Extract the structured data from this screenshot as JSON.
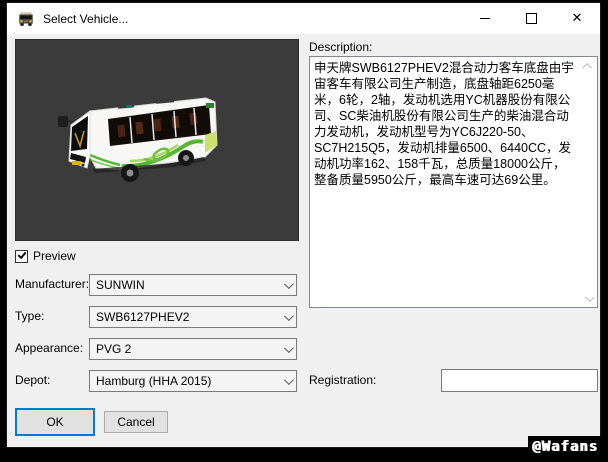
{
  "window": {
    "title": "Select Vehicle...",
    "glyphs": {
      "close": "✕"
    }
  },
  "preview": {
    "checkbox_label": "Preview",
    "checked": true
  },
  "description": {
    "label": "Description:",
    "text": "申天牌SWB6127PHEV2混合动力客车底盘由宇宙客车有限公司生产制造，底盘轴距6250毫米，6轮，2轴，发动机选用YC机器股份有限公司、SC柴油机股份有限公司生产的柴油混合动力发动机，发动机型号为YC6J220-50、SC7H215Q5，发动机排量6500、6440CC，发动机功率162、158千瓦，总质量18000公斤，整备质量5950公斤，最高车速可达69公里。"
  },
  "fields": {
    "manufacturer": {
      "label": "Manufacturer:",
      "value": "SUNWIN"
    },
    "type": {
      "label": "Type:",
      "value": "SWB6127PHEV2"
    },
    "appearance": {
      "label": "Appearance:",
      "value": "PVG 2"
    },
    "depot": {
      "label": "Depot:",
      "value": "Hamburg (HHA 2015)"
    },
    "registration": {
      "label": "Registration:",
      "value": ""
    }
  },
  "buttons": {
    "ok": "OK",
    "cancel": "Cancel"
  },
  "watermark": "@Wafans",
  "colors": {
    "accent": "#0078d7",
    "preview_background": "#3b3b3b",
    "dialog_background": "#f0f0f0",
    "livery_green": "#58b531"
  }
}
